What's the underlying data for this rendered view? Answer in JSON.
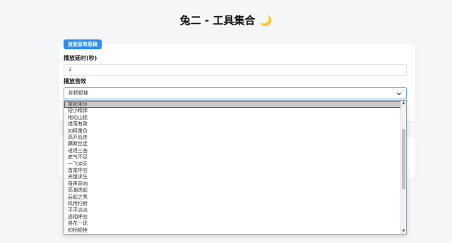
{
  "page": {
    "title": "兔二 - 工具集合 🌙"
  },
  "section": {
    "badge": "放屁音效恶搞",
    "delay_label": "播放延时(秒)",
    "delay_value": "2",
    "sound_label": "播放音效",
    "sound_selected": "抑扬顿挫"
  },
  "dropdown": {
    "options": [
      "意犹未尽",
      "短小精悍",
      "地动山摇",
      "错落有致",
      "如释重负",
      "高开低走",
      "藕断丝连",
      "进退三舍",
      "底气不足",
      "一飞冲天",
      "首尾呼应",
      "夹缝求生",
      "奇声异响",
      "高潮迭起",
      "后起之秀",
      "机枪扫射",
      "平平淡淡",
      "遥相呼应",
      "昙花一现",
      "抑扬顿挫"
    ],
    "highlighted_index": 0
  }
}
